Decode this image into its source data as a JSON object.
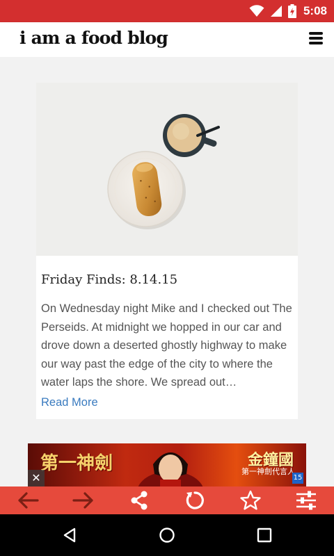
{
  "status_bar": {
    "time": "5:08",
    "icons": [
      "wifi-icon",
      "cell-signal-icon",
      "battery-charging-icon"
    ],
    "color": "#d32f2f"
  },
  "header": {
    "logo_text": "i am a food blog",
    "menu_icon": "menu-icon"
  },
  "post": {
    "image_alt_icon": "bread-and-coffee-photo",
    "title": "Friday Finds: 8.14.15",
    "excerpt": "On Wednesday night Mike and I checked out The Perseids. At midnight we hopped in our car and drove down a deserted ghostly highway to make our way past the edge of the city to where the water laps the shore. We spread out…",
    "read_more": "Read More",
    "link_color": "#3a7bbf"
  },
  "ad": {
    "title_left": "第一神劍",
    "title_right": "金鐘國",
    "subtitle": "第一神劍代言人",
    "close_label": "✕",
    "badge": "15"
  },
  "toolbar": {
    "color": "#e64a3c",
    "buttons": [
      "back-arrow-icon",
      "forward-arrow-icon",
      "share-icon",
      "reload-icon",
      "star-icon",
      "settings-sliders-icon"
    ]
  },
  "nav_bar": {
    "buttons": [
      "back-triangle-icon",
      "home-circle-icon",
      "recents-square-icon"
    ]
  }
}
